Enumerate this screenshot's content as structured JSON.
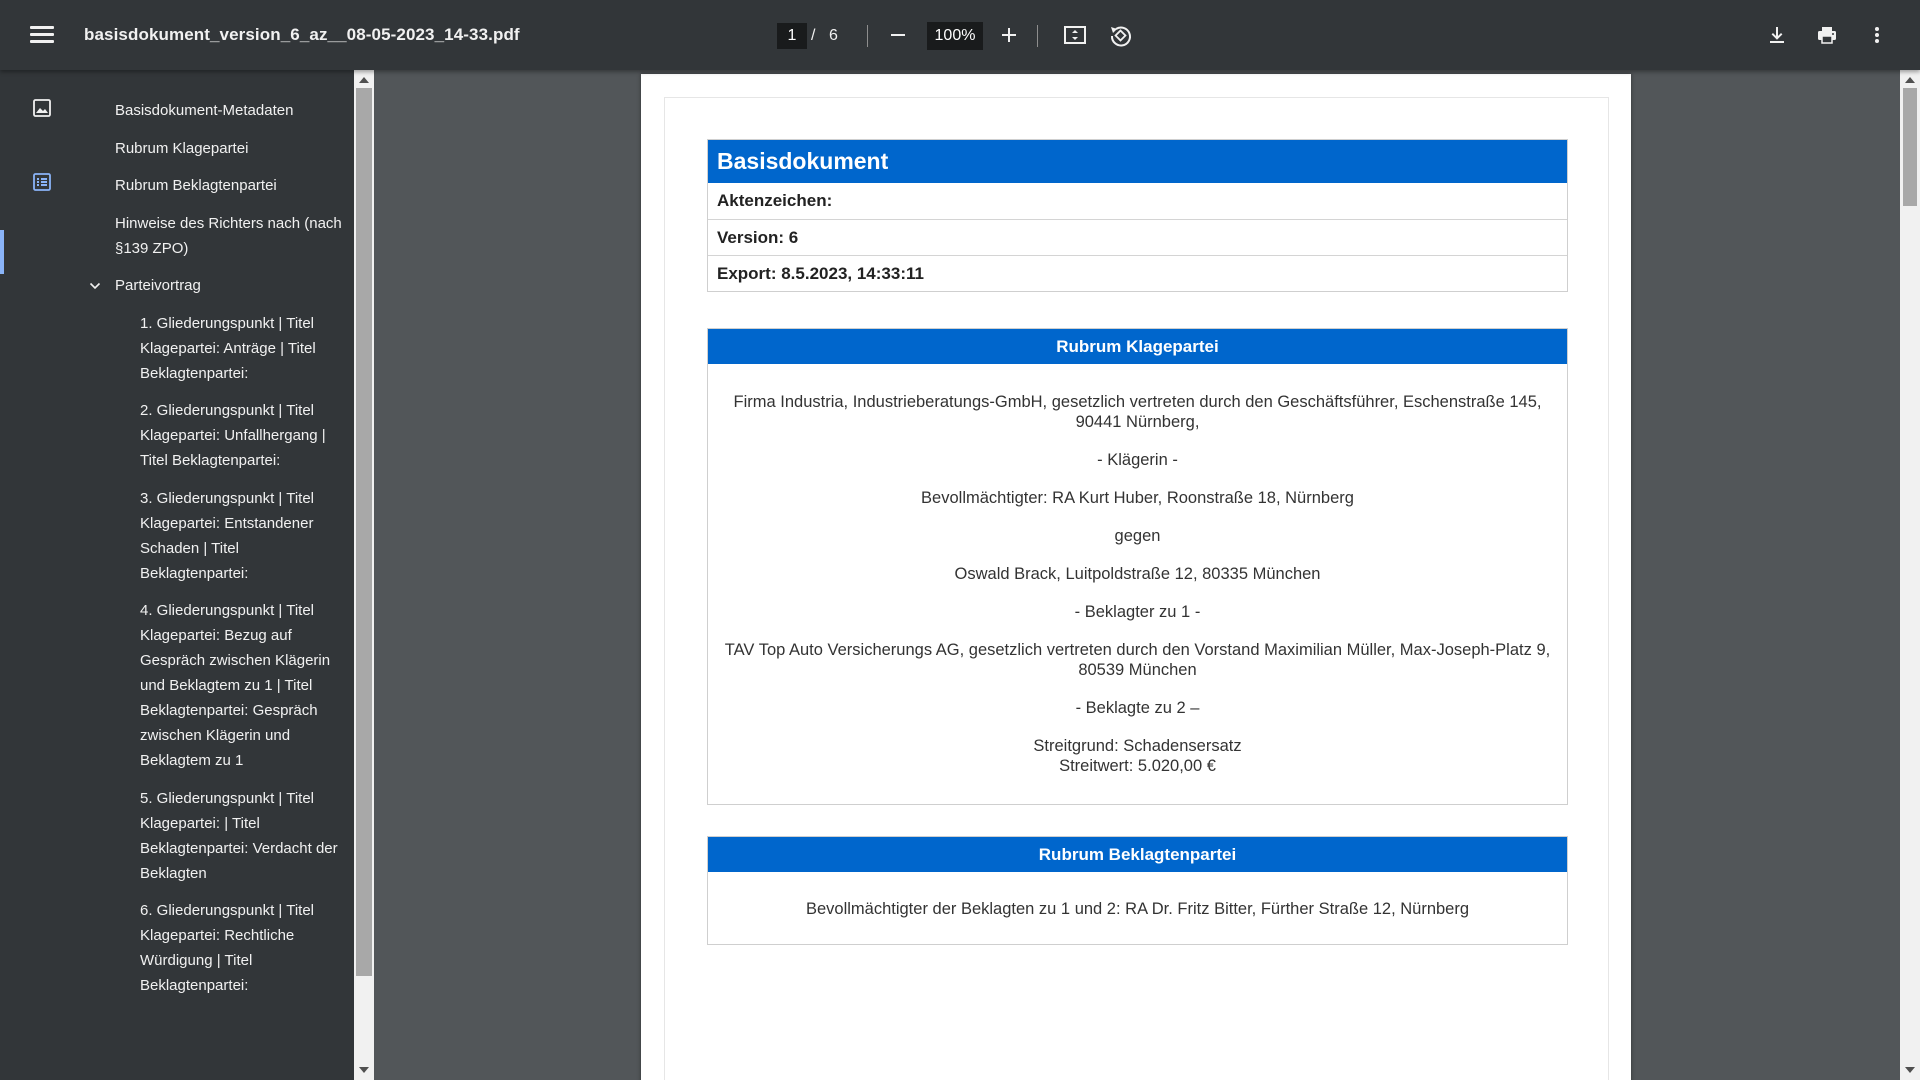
{
  "toolbar": {
    "file_title": "basisdokument_version_6_az__08-05-2023_14-33.pdf",
    "current_page": "1",
    "page_separator": "/",
    "total_pages": "6",
    "zoom": "100%"
  },
  "sidebar": {
    "outline": [
      {
        "label": "Basisdokument-Metadaten"
      },
      {
        "label": "Rubrum Klagepartei"
      },
      {
        "label": "Rubrum Beklagtenpartei"
      },
      {
        "label": "Hinweise des Richters nach (nach §139 ZPO)"
      },
      {
        "label": "Parteivortrag",
        "expanded": true
      },
      {
        "label": "1. Gliederungspunkt | Titel Klagepartei: Anträge | Titel Beklagtenpartei:"
      },
      {
        "label": "2. Gliederungspunkt | Titel Klagepartei: Unfallhergang | Titel Beklagtenpartei:"
      },
      {
        "label": "3. Gliederungspunkt | Titel Klagepartei: Entstandener Schaden | Titel Beklagtenpartei:"
      },
      {
        "label": "4. Gliederungspunkt | Titel Klagepartei: Bezug auf Gespräch zwischen Klägerin und Beklagtem zu 1 | Titel Beklagtenpartei: Gespräch zwischen Klägerin und Beklagtem zu 1"
      },
      {
        "label": "5. Gliederungspunkt | Titel Klagepartei: | Titel Beklagtenpartei: Verdacht der Beklagten"
      },
      {
        "label": "6. Gliederungspunkt | Titel Klagepartei: Rechtliche Würdigung | Titel Beklagtenpartei:"
      }
    ]
  },
  "document": {
    "header": {
      "title": "Basisdokument",
      "aktenzeichen": "Aktenzeichen:",
      "version": "Version: 6",
      "export": "Export: 8.5.2023, 14:33:11"
    },
    "klagepartei": {
      "title": "Rubrum Klagepartei",
      "party": "Firma Industria, Industrieberatungs-GmbH, gesetzlich vertreten durch den Geschäftsführer, Eschenstraße 145, 90441 Nürnberg,",
      "role": "- Klägerin -",
      "counsel": "Bevollmächtigter: RA Kurt Huber, Roonstraße 18, Nürnberg",
      "versus": "gegen",
      "defendant1": "Oswald Brack, Luitpoldstraße 12, 80335 München",
      "defendant1_role": "- Beklagter zu 1 -",
      "defendant2": "TAV Top Auto Versicherungs AG, gesetzlich vertreten durch den Vorstand Maximilian Müller, Max-Joseph-Platz 9, 80539 München",
      "defendant2_role": "- Beklagte zu 2 –",
      "streitgrund": "Streitgrund: Schadensersatz",
      "streitwert": "Streitwert: 5.020,00 €"
    },
    "beklagtenpartei": {
      "title": "Rubrum Beklagtenpartei",
      "counsel": "Bevollmächtigter der Beklagten zu 1 und 2: RA Dr. Fritz Bitter, Fürther Straße 12, Nürnberg"
    }
  }
}
